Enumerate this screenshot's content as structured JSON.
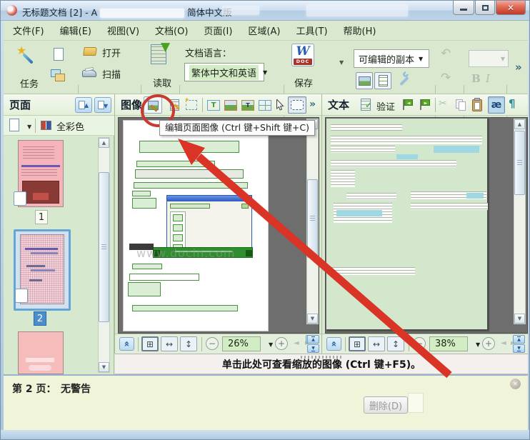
{
  "window": {
    "title_prefix": "无标题文档 [2] - A",
    "title_suffix": "简体中文版"
  },
  "menu": {
    "items": [
      {
        "label": "文件(F)"
      },
      {
        "label": "编辑(E)"
      },
      {
        "label": "视图(V)"
      },
      {
        "label": "文档(O)"
      },
      {
        "label": "页面(I)"
      },
      {
        "label": "区域(A)"
      },
      {
        "label": "工具(T)"
      },
      {
        "label": "帮助(H)"
      }
    ]
  },
  "toolbar": {
    "tasks_label": "任务",
    "open_label": "打开",
    "scan_label": "扫描",
    "read_label": "读取",
    "language_label": "文档语言：",
    "language_value": "繁体中文和英语",
    "save_label": "保存",
    "save_format": "可编辑的副本"
  },
  "pages_panel": {
    "title": "页面",
    "color_mode": "全彩色",
    "pages": [
      {
        "number": "1"
      },
      {
        "number": "2"
      }
    ],
    "selected_page": "2"
  },
  "image_panel": {
    "title": "图像",
    "tooltip": "编辑页面图像 (Ctrl 键+Shift 键+C)",
    "zoom": "26%",
    "watermark": "www.docin.com"
  },
  "text_panel": {
    "title": "文本",
    "verify_label": "验证",
    "zoom": "38%"
  },
  "preview_bar": {
    "text": "单击此处可查看缩放的图像 (Ctrl 键+F5)。"
  },
  "warning_panel": {
    "page_label": "第 2 页：",
    "status": "无警告",
    "delete_label": "删除(D)"
  },
  "icons": {
    "word": "W",
    "doc": "DOC",
    "bold": "B",
    "italic": "I",
    "ae": "æ",
    "pilcrow": "¶",
    "more": "»",
    "check": "✓",
    "star": "★",
    "scissors": "✂",
    "undo": "↶",
    "redo": "↷",
    "up": "▲",
    "down": "▼",
    "left": "◄",
    "right": "►",
    "minus": "−",
    "plus": "+",
    "fit_page": "⊞",
    "fit_width": "↔",
    "fit_height": "↕",
    "collapse": "«",
    "close": "✕",
    "text_area_t": "T",
    "dropdown": "▼"
  },
  "colors": {
    "annotation_red": "#d23425",
    "selection_blue": "#66a4d4",
    "toolbar_bg": "#d9e8cf",
    "warning_bg": "#f0f5da"
  }
}
